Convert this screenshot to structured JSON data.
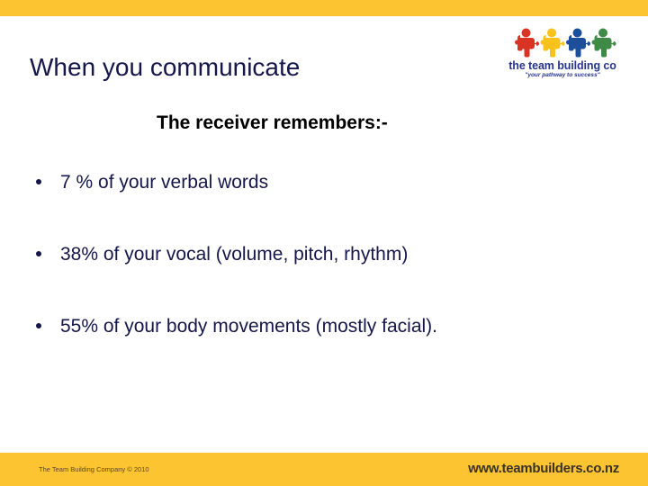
{
  "slide": {
    "title": "When you communicate",
    "subtitle": "The receiver remembers:-",
    "bullets": [
      {
        "text": "7 % of your verbal words"
      },
      {
        "text": "38% of your vocal (volume, pitch, rhythm)"
      },
      {
        "text": "55% of your body movements (mostly facial)."
      }
    ]
  },
  "logo": {
    "name": "the team building co",
    "tagline": "\"your pathway to success\"",
    "figure_colors": [
      "#d93324",
      "#f7c21c",
      "#1d4e9c",
      "#3f8a46"
    ]
  },
  "footer": {
    "copyright": "The Team Building Company © 2010",
    "website": "www.teambuilders.co.nz"
  },
  "colors": {
    "band_yellow": "#fdc431",
    "title_navy": "#15174a",
    "subtitle_black": "#000000",
    "logo_navy": "#27348b",
    "background": "#ffffff"
  }
}
